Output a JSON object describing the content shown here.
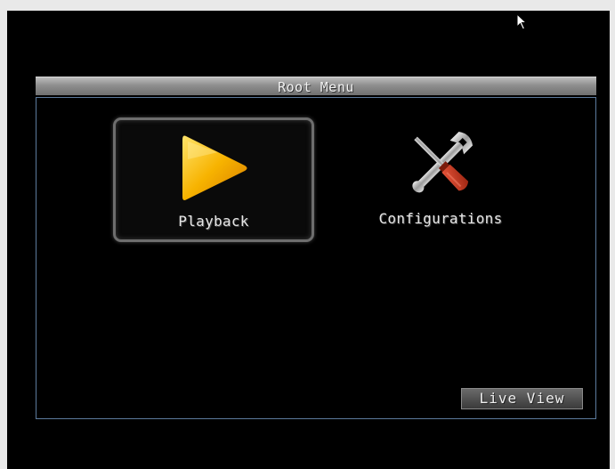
{
  "window": {
    "title": "Root Menu"
  },
  "menu": {
    "items": [
      {
        "label": "Playback",
        "icon": "play-icon",
        "selected": true
      },
      {
        "label": "Configurations",
        "icon": "tools-icon",
        "selected": false
      }
    ]
  },
  "footer": {
    "live_view_label": "Live View"
  },
  "colors": {
    "background": "#000000",
    "frame_border": "#5c7a9c",
    "play_icon": "#f5b400",
    "screwdriver_handle": "#c0381c"
  }
}
